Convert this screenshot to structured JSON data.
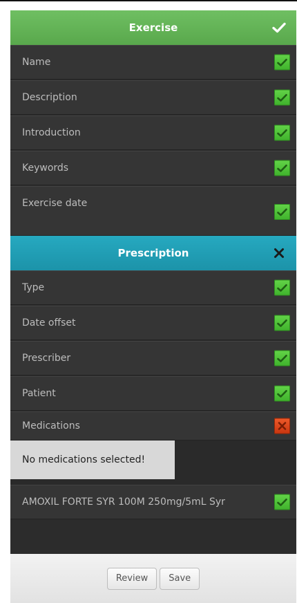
{
  "exercise": {
    "title": "Exercise",
    "status_icon": "checkmark-icon",
    "fields": [
      {
        "label": "Name",
        "status": "valid"
      },
      {
        "label": "Description",
        "status": "valid"
      },
      {
        "label": "Introduction",
        "status": "valid"
      },
      {
        "label": "Keywords",
        "status": "valid"
      },
      {
        "label": "Exercise date",
        "status": "valid"
      }
    ]
  },
  "prescription": {
    "title": "Prescription",
    "status_icon": "close-icon",
    "fields": [
      {
        "label": "Type",
        "status": "valid"
      },
      {
        "label": "Date offset",
        "status": "valid"
      },
      {
        "label": "Prescriber",
        "status": "valid"
      },
      {
        "label": "Patient",
        "status": "valid"
      },
      {
        "label": "Medications",
        "status": "invalid"
      }
    ],
    "warning": "No medications selected!",
    "medication": {
      "label": "AMOXIL FORTE SYR 100M 250mg/5mL Syr",
      "status": "valid"
    }
  },
  "footer": {
    "review_label": "Review",
    "save_label": "Save"
  },
  "colors": {
    "exercise_header": "#5cb050",
    "prescription_header": "#22a0b6",
    "valid": "#4cc438",
    "invalid": "#d9441a",
    "row_bg": "#353535"
  }
}
